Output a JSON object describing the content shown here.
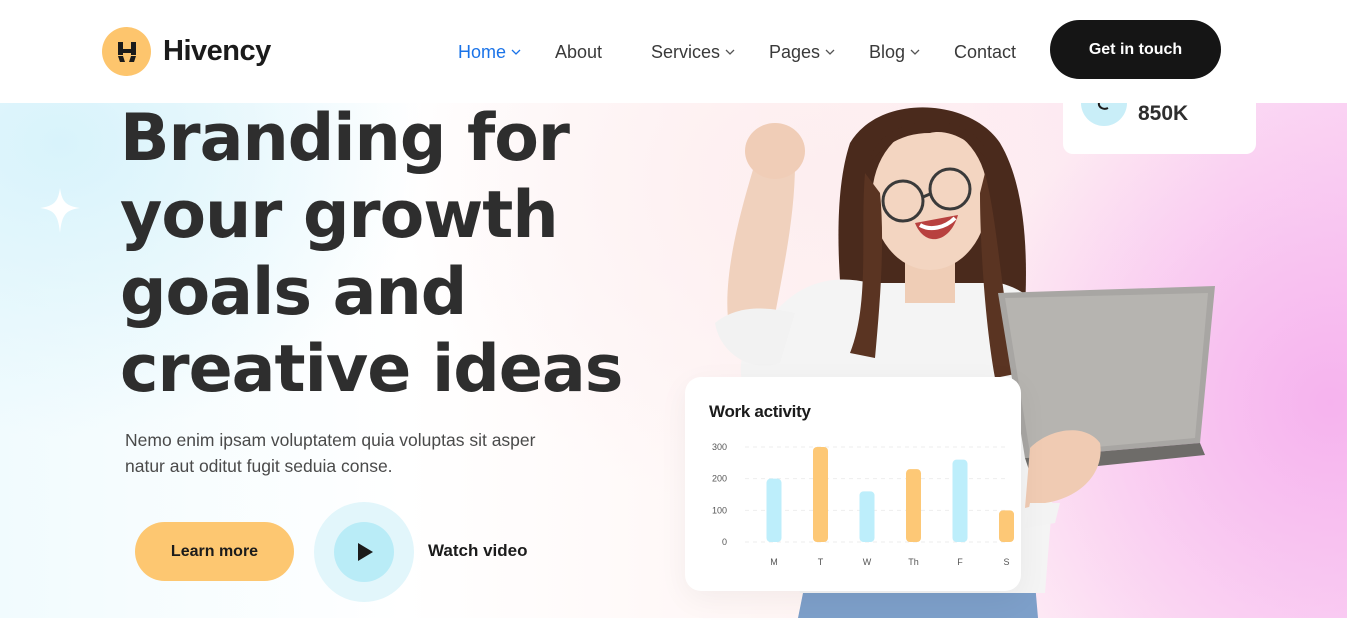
{
  "brand": {
    "name": "Hivency",
    "logo_letter": "H"
  },
  "nav": {
    "items": [
      {
        "label": "Home",
        "has_dropdown": true,
        "active": true
      },
      {
        "label": "About",
        "has_dropdown": false,
        "active": false
      },
      {
        "label": "Services",
        "has_dropdown": true,
        "active": false
      },
      {
        "label": "Pages",
        "has_dropdown": true,
        "active": false
      },
      {
        "label": "Blog",
        "has_dropdown": true,
        "active": false
      },
      {
        "label": "Contact",
        "has_dropdown": false,
        "active": false
      }
    ],
    "cta_label": "Get in touch"
  },
  "hero": {
    "headline_lines": [
      "Branding for",
      "your growth",
      "goals and",
      "creative ideas"
    ],
    "subtext": "Nemo enim ipsam voluptatem quia voluptas sit asper natur aut oditut fugit seduia conse.",
    "learn_more_label": "Learn more",
    "watch_video_label": "Watch video"
  },
  "stat_card": {
    "icon": "chart-icon",
    "value": "850K"
  },
  "colors": {
    "accent_blue": "#1a73e8",
    "brand_yellow": "#fdc56d",
    "bar_blue": "#bdeefb",
    "bar_orange": "#fdc876",
    "cta_dark": "#151515"
  },
  "chart_data": {
    "type": "bar",
    "title": "Work activity",
    "categories": [
      "M",
      "T",
      "W",
      "Th",
      "F",
      "S"
    ],
    "values": [
      200,
      300,
      160,
      230,
      260,
      100
    ],
    "bar_colors": [
      "#bdeefb",
      "#fdc876",
      "#bdeefb",
      "#fdc876",
      "#bdeefb",
      "#fdc876"
    ],
    "y_ticks": [
      "300",
      "200",
      "100",
      "0"
    ],
    "ylim": [
      0,
      300
    ],
    "grid": true
  }
}
